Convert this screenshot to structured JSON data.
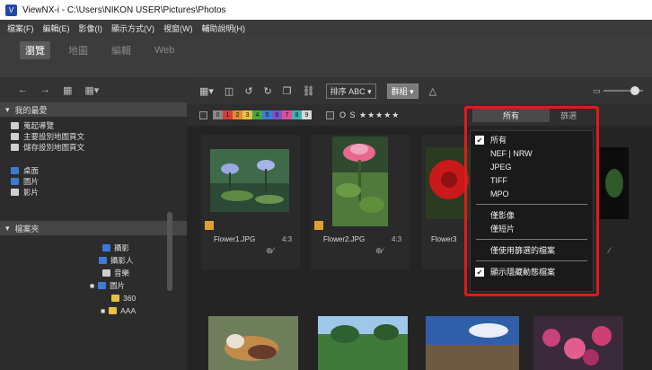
{
  "window": {
    "title": "ViewNX-i - C:\\Users\\NIKON USER\\Pictures\\Photos",
    "app_icon_glyph": "V"
  },
  "menu": [
    "檔案(F)",
    "編輯(E)",
    "影像(I)",
    "顯示方式(V)",
    "視窗(W)",
    "輔助說明(H)"
  ],
  "modes": {
    "browse": "瀏覽",
    "map": "地圖",
    "edit": "編輯",
    "web": "Web"
  },
  "sidebar": {
    "toolbar_icons": [
      "←",
      "→",
      "▦",
      "▦▾"
    ],
    "favorites": {
      "title": "我的最愛",
      "items": [
        "蒐起導覽",
        "主要設別地圖頁文",
        "儲存設別地圖頁文"
      ]
    },
    "places": [
      "桌面",
      "圖片",
      "影片"
    ],
    "folders": {
      "title": "檔案夾",
      "items": [
        "攝影",
        "攝影人",
        "音樂",
        "圖片",
        "360",
        "AAA"
      ]
    }
  },
  "toolbar": {
    "view_btn": "▦▾",
    "sort_btn": "排序 ABC ▾",
    "group_btn": "群組 ▾"
  },
  "filter": {
    "labels": [
      "0",
      "1",
      "2",
      "3",
      "4",
      "5",
      "6",
      "7",
      "8",
      "9"
    ],
    "label_colors": [
      "#8a8a8a",
      "#d63b3b",
      "#e08a33",
      "#e8c043",
      "#45a843",
      "#3d7bd6",
      "#7b54c8",
      "#e04e9a",
      "#3fb1b1",
      "#d9d9d9"
    ],
    "rating": "O S ★★★★★",
    "all_label": "所有",
    "filter_label": "篩選"
  },
  "thumbnails": [
    {
      "name": "Flower1.JPG",
      "ratio": "4:3"
    },
    {
      "name": "Flower2.JPG",
      "ratio": "4:3"
    },
    {
      "name": "Flower3",
      "ratio": ""
    }
  ],
  "dropdown": {
    "items": [
      {
        "label": "所有",
        "checked": true
      },
      {
        "label": "NEF | NRW",
        "checked": false
      },
      {
        "label": "JPEG",
        "checked": false
      },
      {
        "label": "TIFF",
        "checked": false
      },
      {
        "label": "MPO",
        "checked": false
      }
    ],
    "group2": [
      "僅影像",
      "僅短片"
    ],
    "group3": [
      "僅使用篩選的檔案"
    ],
    "group4": [
      {
        "label": "顯示隱藏動態檔案",
        "checked": true
      }
    ]
  },
  "colors": {
    "highlight": "#e01a1a",
    "panel_bg": "#2c2c2c"
  }
}
